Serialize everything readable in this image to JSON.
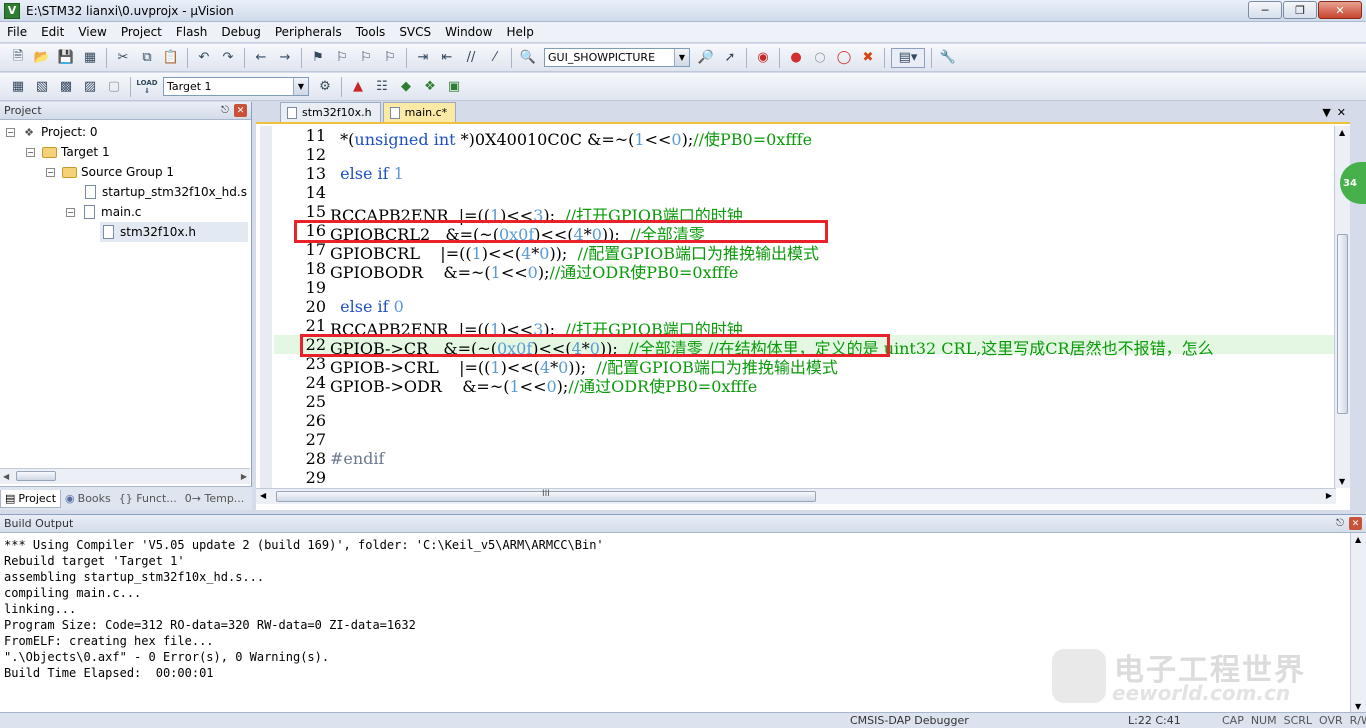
{
  "window": {
    "title": "E:\\STM32 lianxi\\0.uvprojx - µVision",
    "app_icon": "V"
  },
  "menu": [
    "File",
    "Edit",
    "View",
    "Project",
    "Flash",
    "Debug",
    "Peripherals",
    "Tools",
    "SVCS",
    "Window",
    "Help"
  ],
  "toolbar1": {
    "find_value": "GUI_SHOWPICTURE"
  },
  "toolbar2": {
    "target_value": "Target 1",
    "load_label": "LOAD"
  },
  "project_panel": {
    "title": "Project",
    "tree": [
      {
        "label": "Project: 0"
      },
      {
        "label": "Target 1"
      },
      {
        "label": "Source Group 1"
      },
      {
        "label": "startup_stm32f10x_hd.s"
      },
      {
        "label": "main.c"
      },
      {
        "label": "stm32f10x.h"
      }
    ],
    "tabs": [
      "Project",
      "Books",
      "{} Funct...",
      "0→ Temp..."
    ]
  },
  "editor": {
    "tabs": [
      "stm32f10x.h",
      "main.c*"
    ],
    "scroll_label": "III",
    "bubble": "34",
    "lines": [
      {
        "n": "11",
        "parts": [
          [
            "txt",
            "  *("
          ],
          [
            "kw",
            "unsigned int"
          ],
          [
            "txt",
            " *)"
          ],
          [
            "txt",
            "0X40010C0C &=~("
          ],
          [
            "num",
            "1"
          ],
          [
            "txt",
            "<<"
          ],
          [
            "num",
            "0"
          ],
          [
            "txt",
            ");"
          ],
          [
            "cmt",
            "//使PB0=0xfffe"
          ]
        ]
      },
      {
        "n": "12",
        "parts": []
      },
      {
        "n": "13",
        "parts": [
          [
            "kw",
            "  else if "
          ],
          [
            "num",
            "1"
          ]
        ]
      },
      {
        "n": "14",
        "parts": []
      },
      {
        "n": "15",
        "parts": [
          [
            "txt",
            "RCCAPB2ENR  |=(("
          ],
          [
            "num",
            "1"
          ],
          [
            "txt",
            ")<<"
          ],
          [
            "num",
            "3"
          ],
          [
            "txt",
            ");  "
          ],
          [
            "cmt",
            "//打开GPIOB端口的时钟"
          ]
        ]
      },
      {
        "n": "16",
        "parts": [
          [
            "txt",
            "GPIOBCRL2   &=(~("
          ],
          [
            "num",
            "0x0f"
          ],
          [
            "txt",
            ")<<("
          ],
          [
            "num",
            "4"
          ],
          [
            "txt",
            "*"
          ],
          [
            "num",
            "0"
          ],
          [
            "txt",
            "));  "
          ],
          [
            "cmt",
            "//全部清零"
          ]
        ]
      },
      {
        "n": "17",
        "parts": [
          [
            "txt",
            "GPIOBCRL    |=(("
          ],
          [
            "num",
            "1"
          ],
          [
            "txt",
            ")<<("
          ],
          [
            "num",
            "4"
          ],
          [
            "txt",
            "*"
          ],
          [
            "num",
            "0"
          ],
          [
            "txt",
            "));  "
          ],
          [
            "cmt",
            "//配置GPIOB端口为推挽输出模式"
          ]
        ]
      },
      {
        "n": "18",
        "parts": [
          [
            "txt",
            "GPIOBODR    &=~("
          ],
          [
            "num",
            "1"
          ],
          [
            "txt",
            "<<"
          ],
          [
            "num",
            "0"
          ],
          [
            "txt",
            ");"
          ],
          [
            "cmt",
            "//通过ODR使PB0=0xfffe"
          ]
        ]
      },
      {
        "n": "19",
        "parts": []
      },
      {
        "n": "20",
        "parts": [
          [
            "kw",
            "  else if "
          ],
          [
            "num",
            "0"
          ]
        ]
      },
      {
        "n": "21",
        "parts": [
          [
            "txt",
            "RCCAPB2ENR  |=(("
          ],
          [
            "num",
            "1"
          ],
          [
            "txt",
            ")<<"
          ],
          [
            "num",
            "3"
          ],
          [
            "txt",
            ");  "
          ],
          [
            "cmt",
            "//打开GPIOB端口的时钟"
          ]
        ]
      },
      {
        "n": "22",
        "hl": true,
        "parts": [
          [
            "txt",
            "GPIOB->CR   &=(~("
          ],
          [
            "num",
            "0x0f"
          ],
          [
            "txt",
            ")<<("
          ],
          [
            "num",
            "4"
          ],
          [
            "txt",
            "*"
          ],
          [
            "num",
            "0"
          ],
          [
            "txt",
            "));  "
          ],
          [
            "cmt",
            "//全部清零 //在结构体里，定义的是 uint32 CRL,这里写成CR居然也不报错，怎么"
          ]
        ]
      },
      {
        "n": "23",
        "parts": [
          [
            "txt",
            "GPIOB->CRL    |=(("
          ],
          [
            "num",
            "1"
          ],
          [
            "txt",
            ")<<("
          ],
          [
            "num",
            "4"
          ],
          [
            "txt",
            "*"
          ],
          [
            "num",
            "0"
          ],
          [
            "txt",
            "));  "
          ],
          [
            "cmt",
            "//配置GPIOB端口为推挽输出模式"
          ]
        ]
      },
      {
        "n": "24",
        "parts": [
          [
            "txt",
            "GPIOB->ODR    &=~("
          ],
          [
            "num",
            "1"
          ],
          [
            "txt",
            "<<"
          ],
          [
            "num",
            "0"
          ],
          [
            "txt",
            ");"
          ],
          [
            "cmt",
            "//通过ODR使PB0=0xfffe"
          ]
        ]
      },
      {
        "n": "25",
        "parts": []
      },
      {
        "n": "26",
        "parts": []
      },
      {
        "n": "27",
        "parts": []
      },
      {
        "n": "28",
        "parts": [
          [
            "pp",
            "#endif"
          ]
        ]
      },
      {
        "n": "29",
        "parts": []
      }
    ]
  },
  "build_output": {
    "title": "Build Output",
    "lines": [
      "*** Using Compiler 'V5.05 update 2 (build 169)', folder: 'C:\\Keil_v5\\ARM\\ARMCC\\Bin'",
      "Rebuild target 'Target 1'",
      "assembling startup_stm32f10x_hd.s...",
      "compiling main.c...",
      "linking...",
      "Program Size: Code=312 RO-data=320 RW-data=0 ZI-data=1632",
      "FromELF: creating hex file...",
      "\".\\Objects\\0.axf\" - 0 Error(s), 0 Warning(s).",
      "Build Time Elapsed:  00:00:01"
    ],
    "watermark_cn": "电子工程世界",
    "watermark_en": "eeworld.com.cn"
  },
  "status": {
    "debugger": "CMSIS-DAP Debugger",
    "position": "L:22 C:41",
    "flags": "CAP  NUM  SCRL  OVR  R/W"
  },
  "colors": {
    "keyword": "#1f4fc4",
    "number": "#5b9bd5",
    "comment": "#0a9a0a",
    "highlight_box": "#e8212b",
    "current_line": "#e3f7e3"
  }
}
